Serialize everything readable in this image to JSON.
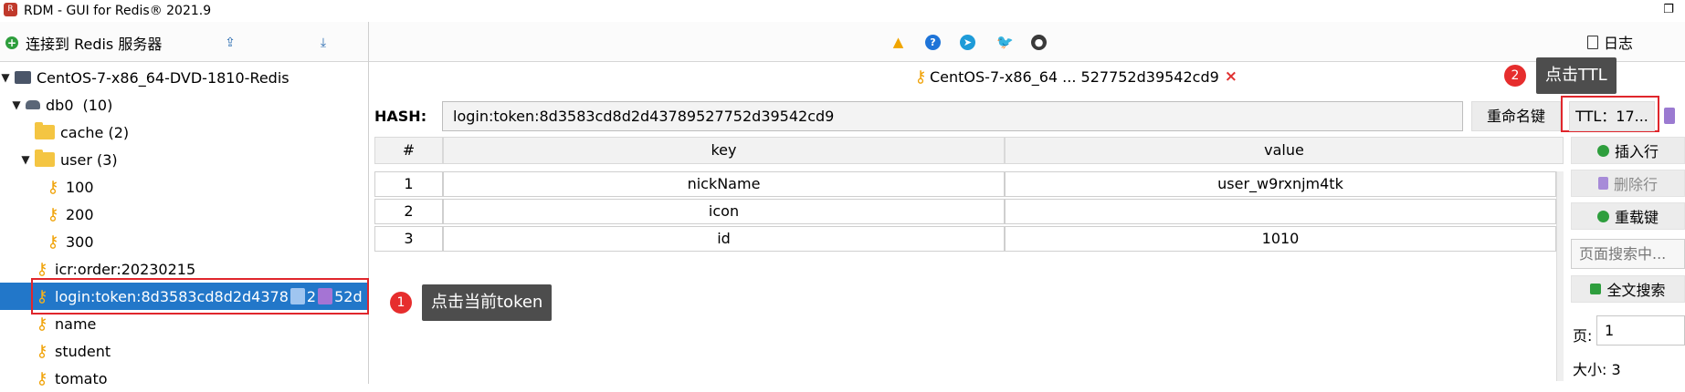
{
  "app": {
    "title": "RDM - GUI for Redis® 2021.9"
  },
  "left_toolbar": {
    "connect_label": "连接到 Redis 服务器"
  },
  "tree": {
    "server": "CentOS-7-x86_64-DVD-1810-Redis",
    "db": "db0",
    "db_count": "(10)",
    "items": [
      {
        "label": "cache (2)",
        "type": "folder"
      },
      {
        "label": "user (3)",
        "type": "folder"
      },
      {
        "label": "100",
        "type": "key"
      },
      {
        "label": "200",
        "type": "key"
      },
      {
        "label": "300",
        "type": "key"
      },
      {
        "label": "icr:order:20230215",
        "type": "key"
      },
      {
        "label_start": "login:token:8d3583cd8d2d4378",
        "label_mid": "2",
        "label_end": "52d",
        "type": "key",
        "selected": true
      },
      {
        "label": "name",
        "type": "key"
      },
      {
        "label": "student",
        "type": "key"
      },
      {
        "label": "tomato",
        "type": "key"
      }
    ]
  },
  "annotations": [
    {
      "number": "1",
      "text": "点击当前token"
    },
    {
      "number": "2",
      "text": "点击TTL"
    }
  ],
  "right_toolbar": {
    "log_label": "日志"
  },
  "tab": {
    "title": "CentOS-7-x86_64 ... 527752d39542cd9",
    "close": "×"
  },
  "key_header": {
    "type_label": "HASH:",
    "key_name": "login:token:8d3583cd8d2d43789527752d39542cd9",
    "rename_label": "重命名键",
    "ttl_label": "TTL：17..."
  },
  "table": {
    "headers": [
      "#",
      "key",
      "value"
    ],
    "rows": [
      [
        "1",
        "nickName",
        "user_w9rxnjm4tk"
      ],
      [
        "2",
        "icon",
        ""
      ],
      [
        "3",
        "id",
        "1010"
      ]
    ]
  },
  "side_panel": {
    "insert_label": "插入行",
    "delete_label": "删除行",
    "reload_label": "重载键",
    "search_placeholder": "页面搜索中...",
    "fulltext_label": "全文搜索",
    "page_label": "页:",
    "page_value": "1",
    "size_label": "大小: 3"
  }
}
